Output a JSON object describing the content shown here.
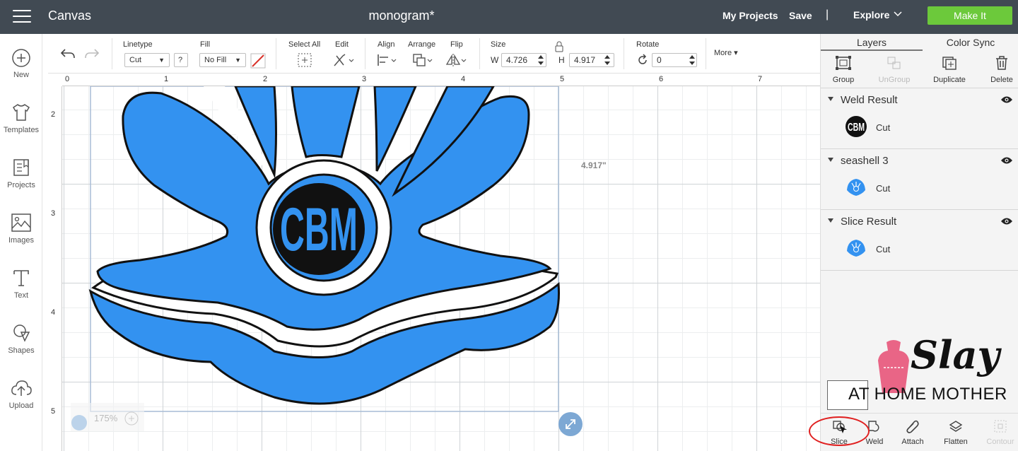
{
  "topbar": {
    "app_title": "Canvas",
    "doc_title": "monogram*",
    "my_projects": "My Projects",
    "save": "Save",
    "separator": "|",
    "explore": "Explore",
    "make_it": "Make It",
    "make_it_color": "#6cc93b"
  },
  "leftbar": {
    "items": [
      {
        "label": "New",
        "icon": "plus-circle-icon"
      },
      {
        "label": "Templates",
        "icon": "shirt-icon"
      },
      {
        "label": "Projects",
        "icon": "projects-icon"
      },
      {
        "label": "Images",
        "icon": "image-icon"
      },
      {
        "label": "Text",
        "icon": "text-icon"
      },
      {
        "label": "Shapes",
        "icon": "shapes-icon"
      },
      {
        "label": "Upload",
        "icon": "upload-cloud-icon"
      }
    ]
  },
  "toolbar": {
    "linetype_label": "Linetype",
    "linetype_value": "Cut",
    "help": "?",
    "fill_label": "Fill",
    "fill_value": "No Fill",
    "select_all_label": "Select All",
    "edit_label": "Edit",
    "align_label": "Align",
    "arrange_label": "Arrange",
    "flip_label": "Flip",
    "size_label": "Size",
    "w_label": "W",
    "w_value": "4.726",
    "h_label": "H",
    "h_value": "4.917",
    "rotate_label": "Rotate",
    "rotate_value": "0",
    "more_label": "More"
  },
  "rulers": {
    "top": [
      "0",
      "1",
      "2",
      "3",
      "4",
      "5",
      "6",
      "7"
    ],
    "left": [
      "2",
      "3",
      "4",
      "5"
    ]
  },
  "canvas": {
    "monogram_text": "CBM",
    "dimension_label": "4.917\"",
    "zoom_value": "175%",
    "shape_color": "#3392f0"
  },
  "rightpanel": {
    "tabs": [
      "Layers",
      "Color Sync"
    ],
    "actions": [
      {
        "label": "Group",
        "icon": "group-icon",
        "enabled": true
      },
      {
        "label": "UnGroup",
        "icon": "ungroup-icon",
        "enabled": false
      },
      {
        "label": "Duplicate",
        "icon": "duplicate-icon",
        "enabled": true
      },
      {
        "label": "Delete",
        "icon": "trash-icon",
        "enabled": true
      }
    ],
    "layers": [
      {
        "name": "Weld Result",
        "item": "Cut",
        "thumb": "monogram"
      },
      {
        "name": "seashell 3",
        "item": "Cut",
        "thumb": "shell"
      },
      {
        "name": "Slice Result",
        "item": "Cut",
        "thumb": "shell"
      }
    ],
    "bottom_actions": [
      {
        "label": "Slice",
        "icon": "slice-icon",
        "enabled": true
      },
      {
        "label": "Weld",
        "icon": "weld-icon",
        "enabled": true
      },
      {
        "label": "Attach",
        "icon": "paperclip-icon",
        "enabled": true
      },
      {
        "label": "Flatten",
        "icon": "flatten-icon",
        "enabled": true
      },
      {
        "label": "Contour",
        "icon": "contour-icon",
        "enabled": false
      }
    ]
  },
  "watermark": {
    "line1": "Slay",
    "line2": "AT HOME MOTHER"
  }
}
